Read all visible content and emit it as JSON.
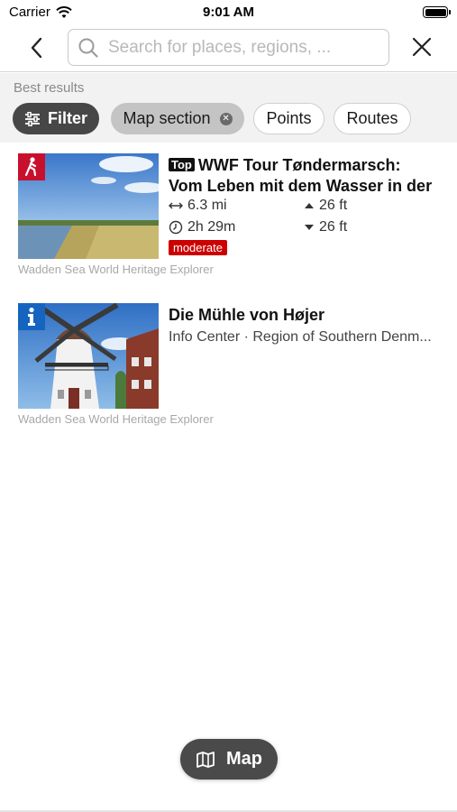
{
  "status_bar": {
    "carrier": "Carrier",
    "time": "9:01 AM"
  },
  "search": {
    "placeholder": "Search for places, regions, ..."
  },
  "filters": {
    "section_label": "Best results",
    "filter_label": "Filter",
    "map_section_label": "Map section",
    "points_label": "Points",
    "routes_label": "Routes"
  },
  "results": [
    {
      "tag": "Top",
      "title": "WWF Tour Tøndermarsch: Vom Leben mit dem Wasser in der",
      "distance": "6.3 mi",
      "duration": "2h 29m",
      "ascent": "26 ft",
      "descent": "26 ft",
      "difficulty": "moderate",
      "provider": "Wadden Sea World Heritage Explorer",
      "icon": "hiking-icon",
      "color": "#c8102e"
    },
    {
      "title": "Die Mühle von Højer",
      "subtitle": "Info Center · Region of Southern Denm...",
      "provider": "Wadden Sea World Heritage Explorer",
      "icon": "info-icon",
      "color": "#1565c0"
    }
  ],
  "map_button": {
    "label": "Map"
  }
}
